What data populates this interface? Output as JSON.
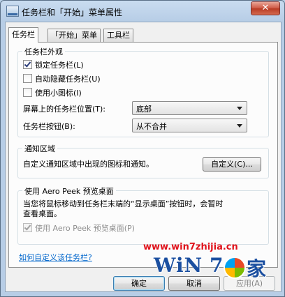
{
  "window": {
    "title": "任务栏和「开始」菜单属性",
    "close_glyph": "✕"
  },
  "tabs": [
    {
      "label": "任务栏",
      "active": true
    },
    {
      "label": "「开始」菜单",
      "active": false
    },
    {
      "label": "工具栏",
      "active": false
    }
  ],
  "appearance": {
    "legend": "任务栏外观",
    "lock_taskbar": {
      "label": "锁定任务栏(L)",
      "checked": true
    },
    "autohide": {
      "label": "自动隐藏任务栏(U)",
      "checked": false
    },
    "small_icons": {
      "label": "使用小图标(I)",
      "checked": false
    },
    "location_label": "屏幕上的任务栏位置(T):",
    "location_value": "底部",
    "buttons_label": "任务栏按钮(B):",
    "buttons_value": "从不合并"
  },
  "notification": {
    "legend": "通知区域",
    "description": "自定义通知区域中出现的图标和通知。",
    "customize_button": "自定义(C)..."
  },
  "aero_peek": {
    "legend": "使用 Aero Peek 预览桌面",
    "description_line1": "当您将鼠标移动到任务栏末端的“显示桌面”按钮时，会暂时",
    "description_line2": "查看桌面。",
    "checkbox": {
      "label": "使用 Aero Peek 预览桌面(P)",
      "checked": true,
      "enabled": false
    }
  },
  "help_link": "如何自定义该任务栏?",
  "buttons": {
    "ok": "确定",
    "cancel": "取消",
    "apply": "应用(A)"
  },
  "watermark": {
    "url": "www.win7zhijia.cn",
    "logo_win": "WiN",
    "logo_seven": "7",
    "logo_jia": "家"
  }
}
